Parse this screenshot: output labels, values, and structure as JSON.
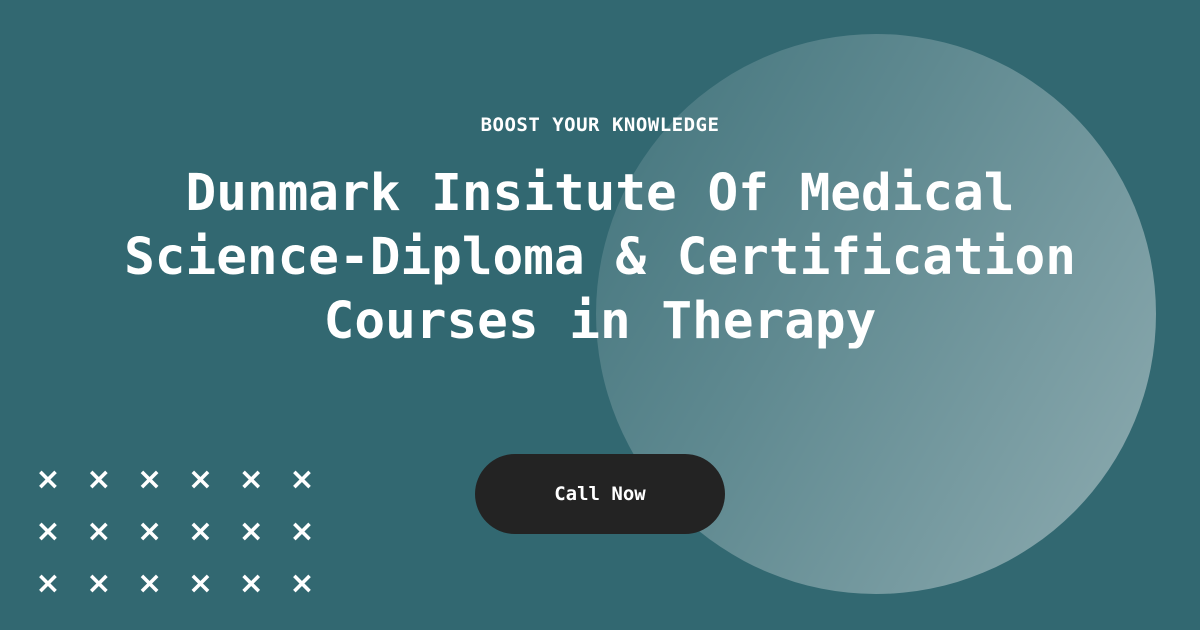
{
  "eyebrow": "BOOST YOUR KNOWLEDGE",
  "headline": "Dunmark Insitute Of Medical Science-Diploma & Certification Courses in Therapy",
  "cta_label": "Call Now",
  "colors": {
    "background": "#326871",
    "button": "#232323",
    "text": "#ffffff"
  },
  "decoration": {
    "icon": "x-mark-icon",
    "rows": 3,
    "cols": 6
  }
}
